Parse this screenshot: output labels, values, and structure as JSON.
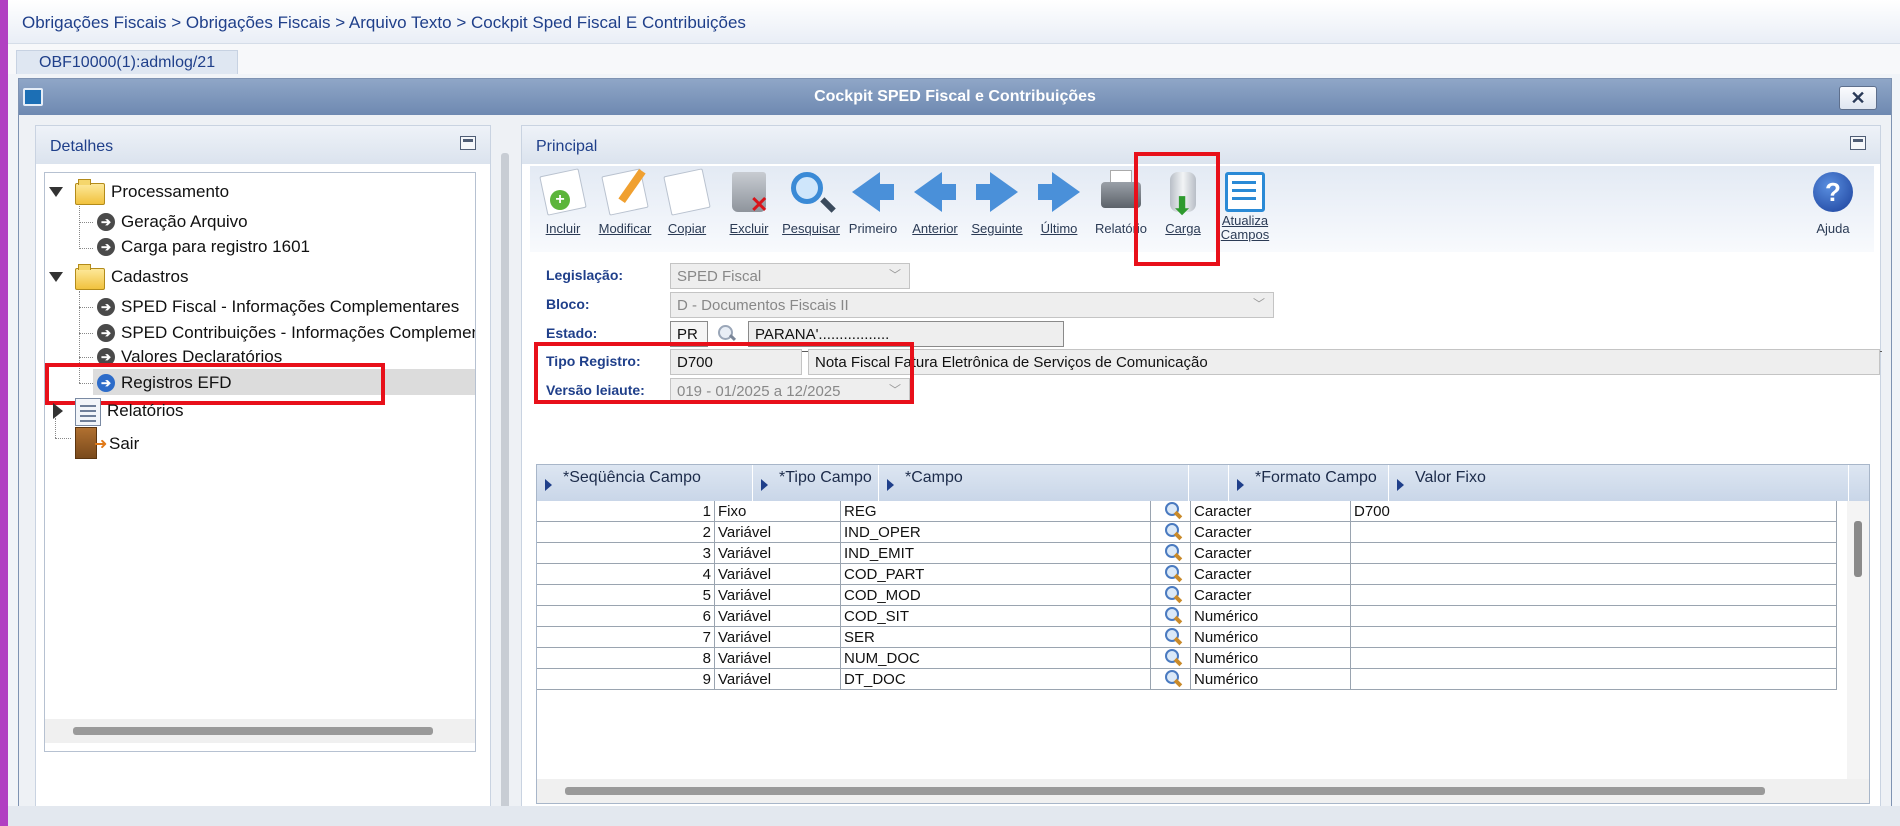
{
  "breadcrumb": "Obrigações Fiscais > Obrigações Fiscais > Arquivo Texto > Cockpit Sped Fiscal E Contribuições",
  "session_tab": "OBF10000(1):admlog/21",
  "window": {
    "title": "Cockpit SPED Fiscal e Contribuições",
    "close_symbol": "✕"
  },
  "left_panel": {
    "title": "Detalhes",
    "tree": {
      "processamento": "Processamento",
      "geracao_arquivo": "Geração Arquivo",
      "carga_1601": "Carga para registro 1601",
      "cadastros": "Cadastros",
      "sped_fiscal_info": "SPED Fiscal - Informações Complementares",
      "sped_contrib_info": "SPED Contribuições - Informações Complementares",
      "valores_declaratorios": "Valores Declaratórios",
      "registros_efd": "Registros EFD",
      "relatorios": "Relatórios",
      "sair": "Sair"
    }
  },
  "right_panel": {
    "title": "Principal",
    "toolbar": {
      "incluir": "Incluir",
      "modificar": "Modificar",
      "copiar": "Copiar",
      "excluir": "Excluir",
      "pesquisar": "Pesquisar",
      "primeiro": "Primeiro",
      "anterior": "Anterior",
      "seguinte": "Seguinte",
      "ultimo": "Último",
      "relatorio": "Relatório",
      "carga": "Carga",
      "atualiza_campos": "Atualiza Campos",
      "ajuda": "Ajuda"
    },
    "form": {
      "legislacao_label": "Legislação:",
      "legislacao_value": "SPED Fiscal",
      "bloco_label": "Bloco:",
      "bloco_value": "D - Documentos Fiscais II",
      "estado_label": "Estado:",
      "estado_code": "PR",
      "estado_name": "PARANA'.................",
      "tipo_registro_label": "Tipo Registro:",
      "tipo_registro_code": "D700",
      "tipo_registro_desc": "Nota Fiscal Fatura Eletrônica de Serviços de Comunicação",
      "versao_label": "Versão leiaute:",
      "versao_value": "019 - 01/2025 a 12/2025"
    },
    "grid": {
      "headers": {
        "sequencia": "*Seqüência Campo",
        "tipo": "*Tipo Campo",
        "campo": "*Campo",
        "formato": "*Formato Campo",
        "valor_fixo": "Valor Fixo"
      },
      "rows": [
        {
          "seq": "1",
          "tipo": "Fixo",
          "campo": "REG",
          "formato": "Caracter",
          "valor": "D700"
        },
        {
          "seq": "2",
          "tipo": "Variável",
          "campo": "IND_OPER",
          "formato": "Caracter",
          "valor": ""
        },
        {
          "seq": "3",
          "tipo": "Variável",
          "campo": "IND_EMIT",
          "formato": "Caracter",
          "valor": ""
        },
        {
          "seq": "4",
          "tipo": "Variável",
          "campo": "COD_PART",
          "formato": "Caracter",
          "valor": ""
        },
        {
          "seq": "5",
          "tipo": "Variável",
          "campo": "COD_MOD",
          "formato": "Caracter",
          "valor": ""
        },
        {
          "seq": "6",
          "tipo": "Variável",
          "campo": "COD_SIT",
          "formato": "Numérico",
          "valor": ""
        },
        {
          "seq": "7",
          "tipo": "Variável",
          "campo": "SER",
          "formato": "Numérico",
          "valor": ""
        },
        {
          "seq": "8",
          "tipo": "Variável",
          "campo": "NUM_DOC",
          "formato": "Numérico",
          "valor": ""
        },
        {
          "seq": "9",
          "tipo": "Variável",
          "campo": "DT_DOC",
          "formato": "Numérico",
          "valor": ""
        }
      ]
    }
  },
  "colors": {
    "highlight": "#e8101a",
    "accent_text": "#1f3f8a",
    "title_bar": "#7a93b8"
  }
}
